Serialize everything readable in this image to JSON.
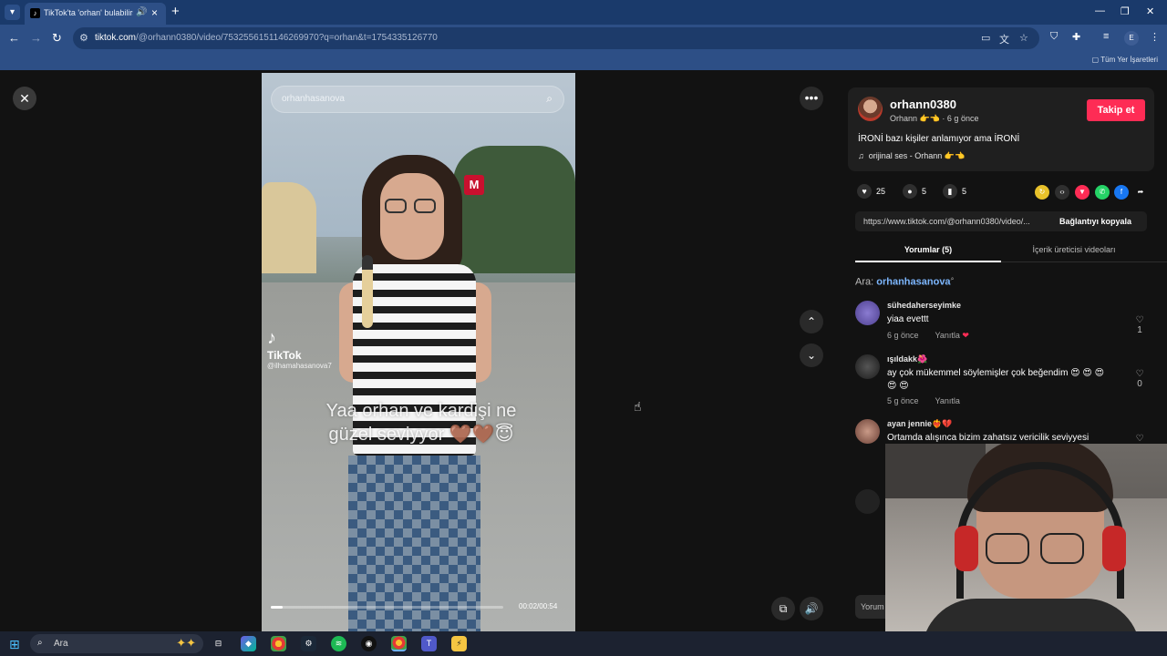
{
  "browser": {
    "tab_title": "TikTok'ta 'orhan' bulabilirsin",
    "new_tab": "+",
    "url_host": "tiktok.com",
    "url_path": "/@orhann0380/video/7532556151146269970?q=orhan&t=1754335126770",
    "bookmarks_label": "Tüm Yer İşaretleri",
    "profile_initial": "E"
  },
  "video": {
    "search_query": "orhanhasanova",
    "watermark_brand": "TikTok",
    "watermark_user": "@ilhamahasanova7",
    "caption": "Yaa orhan ve kardişi ne güzel seviyyor 🤎🤎😇",
    "time": "00:02/00:54",
    "progress": 0.05,
    "metro_sign": "M"
  },
  "author": {
    "username": "orhann0380",
    "subline": "Orhann 👉👈 · 6 g önce",
    "follow_label": "Takip et",
    "description": "İRONİ bazı kişiler anlamıyor ama İRONİ",
    "music": "orijinal ses - Orhann 👉👈"
  },
  "stats": {
    "likes": "25",
    "comments": "5",
    "saves": "5"
  },
  "share_link": {
    "url": "https://www.tiktok.com/@orhann0380/video/...",
    "copy_label": "Bağlantıyı kopyala"
  },
  "panel_tabs": {
    "comments": "Yorumlar (5)",
    "creator_videos": "İçerik üreticisi videoları"
  },
  "search_hint": {
    "prefix": "Ara:",
    "term": "orhanhasanova"
  },
  "comments": [
    {
      "user": "sühedaherseyimke",
      "text": "yiaa evettt",
      "time": "6 g önce",
      "reply": "Yanıtla",
      "likes": "1"
    },
    {
      "user": "ışıldakk🌺",
      "text": "ay çok mükemmel söylemişler çok beğendim 😍 😍 😍 😍 😍",
      "time": "5 g önce",
      "reply": "Yanıtla",
      "likes": "0"
    },
    {
      "user": "ayan jennie❤️‍🔥💔",
      "text": "Ortamda alışınca bizim zahatsız vericilik seviyyesi",
      "time": "",
      "reply": "",
      "likes": ""
    }
  ],
  "comment_input_placeholder": "Yorum",
  "taskbar": {
    "search_placeholder": "Ara"
  },
  "colors": {
    "accent": "#fe2c55",
    "link": "#7db7ff",
    "chrome": "#2d4f86"
  }
}
